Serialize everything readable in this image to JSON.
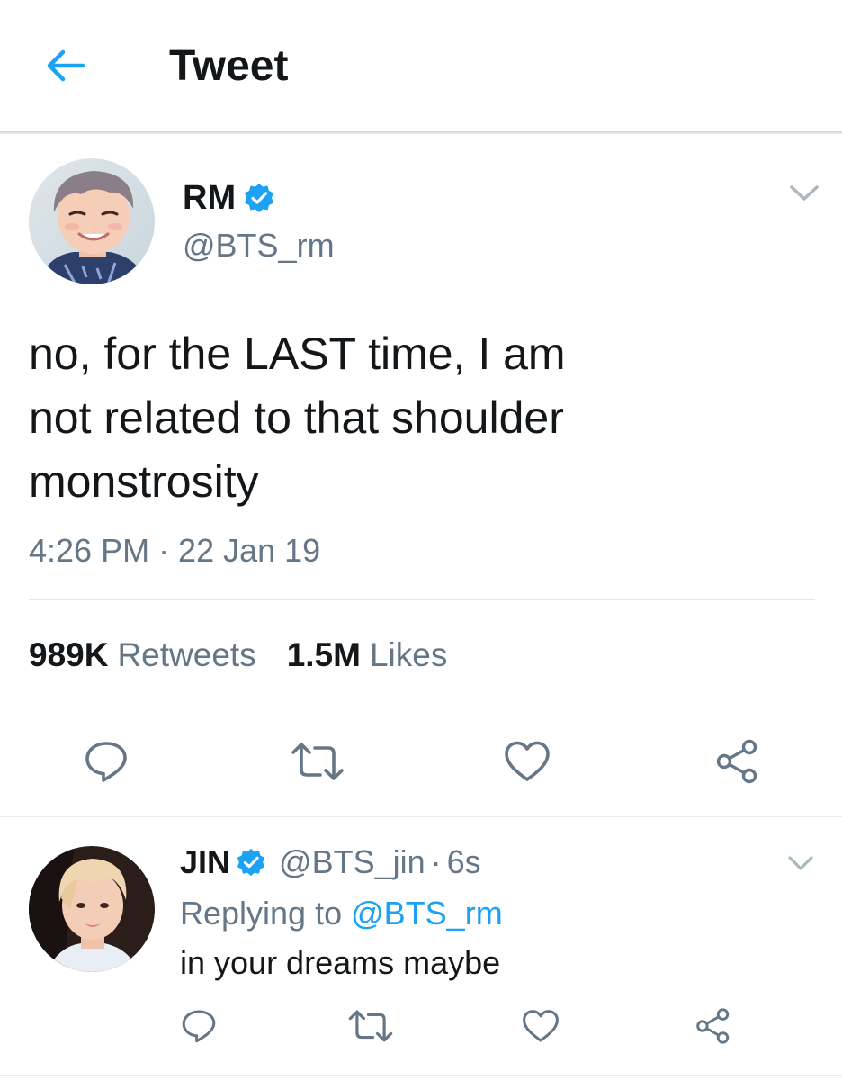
{
  "header": {
    "title": "Tweet",
    "back_icon": "arrow-left-icon"
  },
  "colors": {
    "accent": "#1da1f2",
    "text_primary": "#14171a",
    "text_secondary": "#657786",
    "divider": "#e1e8ed",
    "verified": "#1da1f2"
  },
  "main_tweet": {
    "author_name": "RM",
    "author_handle": "@BTS_rm",
    "verified": true,
    "text_lines": [
      "no, for the LAST time, I am",
      "not related to that shoulder",
      "monstrosity"
    ],
    "timestamp": "4:26 PM · 22 Jan 19",
    "stats": {
      "retweets_count": "989K",
      "retweets_label": "Retweets",
      "likes_count": "1.5M",
      "likes_label": "Likes"
    },
    "actions": [
      "reply-icon",
      "retweet-icon",
      "like-icon",
      "share-icon"
    ]
  },
  "reply": {
    "author_name": "JIN",
    "author_handle": "@BTS_jin",
    "separator": "·",
    "time": "6s",
    "verified": true,
    "replying_label": "Replying to",
    "replying_handle": "@BTS_rm",
    "text": "in your dreams maybe",
    "actions": [
      "reply-icon",
      "retweet-icon",
      "like-icon",
      "share-icon"
    ]
  }
}
